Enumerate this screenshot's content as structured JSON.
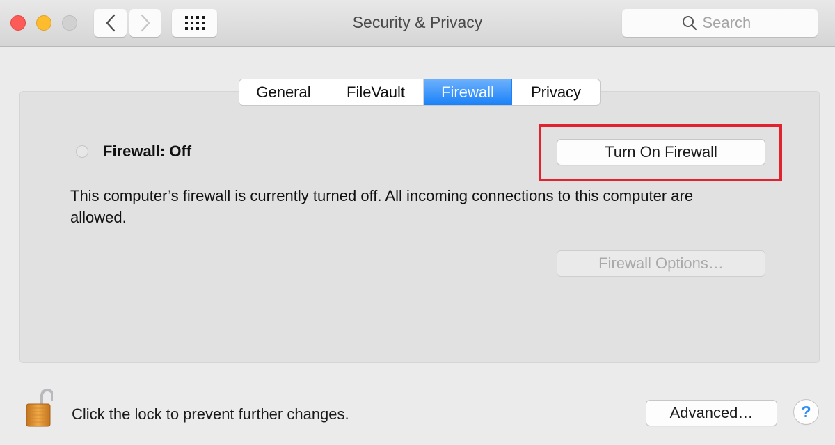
{
  "window": {
    "title": "Security & Privacy",
    "traffic_lights": [
      "close",
      "minimize",
      "zoom"
    ]
  },
  "toolbar": {
    "back_icon": "chevron-left-icon",
    "forward_icon": "chevron-right-icon",
    "show_all_icon": "grid-icon",
    "search": {
      "placeholder": "Search",
      "value": "",
      "icon": "search-icon"
    }
  },
  "tabs": [
    {
      "label": "General",
      "active": false
    },
    {
      "label": "FileVault",
      "active": false
    },
    {
      "label": "Firewall",
      "active": true
    },
    {
      "label": "Privacy",
      "active": false
    }
  ],
  "firewall": {
    "status_label": "Firewall: Off",
    "turn_on_button": "Turn On Firewall",
    "description": "This computer’s firewall is currently turned off. All incoming connections to this computer are allowed.",
    "options_button": "Firewall Options…",
    "options_enabled": false
  },
  "footer": {
    "lock_icon": "unlocked-padlock-icon",
    "lock_text": "Click the lock to prevent further changes.",
    "advanced_button": "Advanced…",
    "help_label": "?"
  },
  "colors": {
    "active_tab": "#1a81f8",
    "highlight": "#e2222e",
    "help": "#2d8df6"
  }
}
